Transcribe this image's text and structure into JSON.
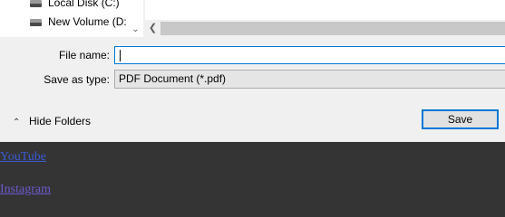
{
  "nav_tree": {
    "items": [
      {
        "label": "Local Disk (C:)"
      },
      {
        "label": "New Volume (D:"
      }
    ]
  },
  "form": {
    "file_name_label": "File name:",
    "file_name_value": "",
    "save_as_type_label": "Save as type:",
    "save_as_type_value": "PDF Document (*.pdf)"
  },
  "footer": {
    "hide_folders_label": "Hide Folders",
    "save_label": "Save"
  },
  "background_links": [
    {
      "label": "YouTube"
    },
    {
      "label": "Instagram"
    }
  ],
  "icons": {
    "scroll_down": "chevron-down-icon",
    "scroll_left": "chevron-left-icon",
    "hide_folders": "chevron-up-icon",
    "drive": "drive-icon"
  }
}
